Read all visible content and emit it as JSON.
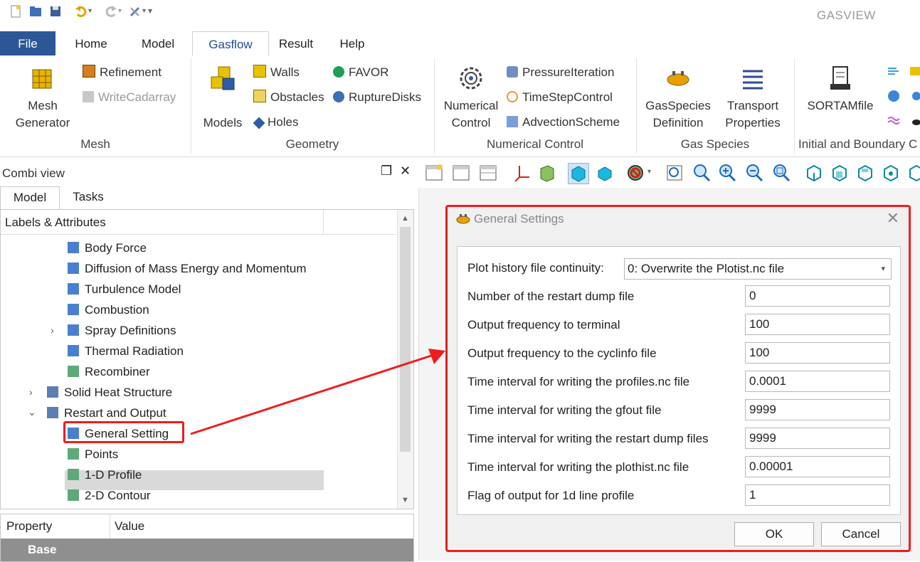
{
  "app": {
    "title": "GASVIEW"
  },
  "ribbon_tabs": [
    "File",
    "Home",
    "Model",
    "Gasflow",
    "Result",
    "Help"
  ],
  "ribbon": {
    "mesh": {
      "label": "Mesh",
      "big_line1": "Mesh",
      "big_line2": "Generator",
      "refinement": "Refinement",
      "writecadarray": "WriteCadarray"
    },
    "geometry": {
      "label": "Geometry",
      "models": "Models",
      "walls": "Walls",
      "obstacles": "Obstacles",
      "holes": "Holes",
      "favor": "FAVOR",
      "rupture": "RuptureDisks"
    },
    "numerical": {
      "label": "Numerical Control",
      "big_line1": "Numerical",
      "big_line2": "Control",
      "pressure": "PressureIteration",
      "timestep": "TimeStepControl",
      "advection": "AdvectionScheme"
    },
    "gas_species": {
      "label": "Gas Species",
      "def_line1": "GasSpecies",
      "def_line2": "Definition",
      "tp_line1": "Transport",
      "tp_line2": "Properties"
    },
    "initial": {
      "label": "Initial and Boundary C",
      "sortam": "SORTAMfile"
    }
  },
  "combi": {
    "title": "Combi view",
    "tabs": [
      "Model",
      "Tasks"
    ],
    "header": "Labels & Attributes",
    "tree": [
      {
        "label": "Body Force",
        "depth": 2,
        "twisty": ""
      },
      {
        "label": "Diffusion of Mass Energy and Momentum",
        "depth": 2,
        "twisty": ""
      },
      {
        "label": "Turbulence Model",
        "depth": 2,
        "twisty": ""
      },
      {
        "label": "Combustion",
        "depth": 2,
        "twisty": ""
      },
      {
        "label": "Spray Definitions",
        "depth": 2,
        "twisty": ">"
      },
      {
        "label": "Thermal Radiation",
        "depth": 2,
        "twisty": ""
      },
      {
        "label": "Recombiner",
        "depth": 2,
        "twisty": ""
      },
      {
        "label": "Solid Heat Structure",
        "depth": 1,
        "twisty": ">"
      },
      {
        "label": "Restart and Output",
        "depth": 1,
        "twisty": "v"
      },
      {
        "label": "General Setting",
        "depth": 2,
        "twisty": ""
      },
      {
        "label": "Points",
        "depth": 2,
        "twisty": ""
      },
      {
        "label": "1-D Profile",
        "depth": 2,
        "twisty": ""
      },
      {
        "label": "2-D Contour",
        "depth": 2,
        "twisty": ""
      }
    ],
    "property_header": {
      "property": "Property",
      "value": "Value"
    },
    "property_group": "Base"
  },
  "dialog": {
    "title": "General Settings",
    "plot_history_label": "Plot history file continuity:",
    "plot_history_value": "0: Overwrite the Plotist.nc file",
    "rows": [
      {
        "label": "Number of the restart dump file",
        "value": "0"
      },
      {
        "label": "Output frequency to terminal",
        "value": "100"
      },
      {
        "label": "Output frequency to the cyclinfo file",
        "value": "100"
      },
      {
        "label": "Time interval for writing the profiles.nc file",
        "value": "0.0001"
      },
      {
        "label": "Time interval for writing the gfout file",
        "value": "9999"
      },
      {
        "label": "Time interval for writing the restart dump files",
        "value": "9999"
      },
      {
        "label": "Time interval for writing the plothist.nc file",
        "value": "0.00001"
      },
      {
        "label": "Flag of output for 1d line profile",
        "value": "1"
      }
    ],
    "ok": "OK",
    "cancel": "Cancel"
  },
  "colors": {
    "accent": "#2b5797",
    "highlight": "#ee1d1d",
    "selection": "#d9d9d9"
  }
}
